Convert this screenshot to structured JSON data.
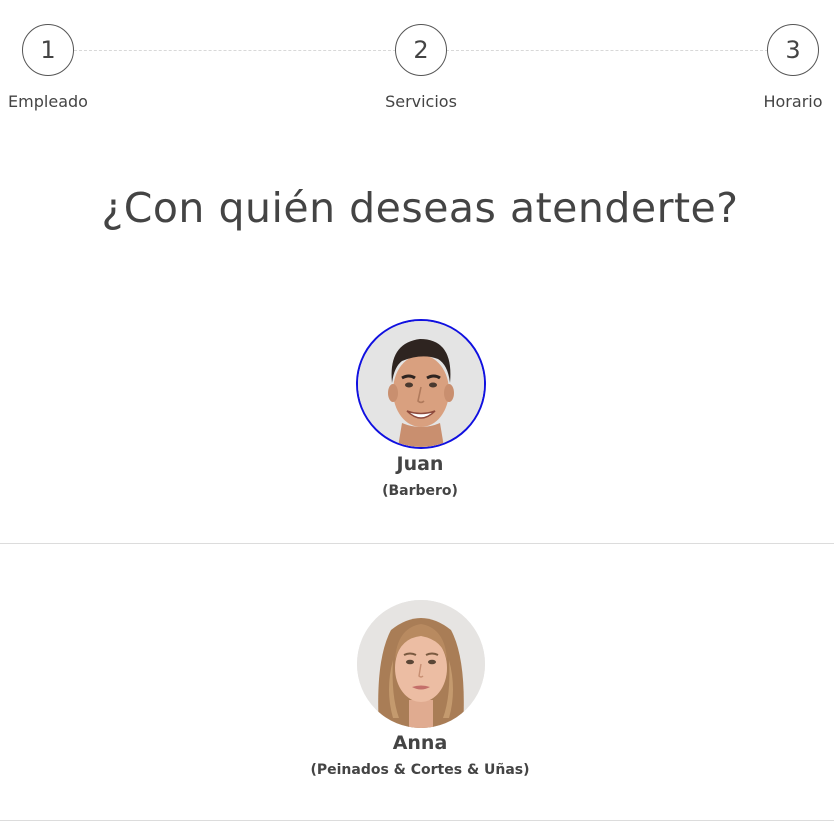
{
  "steps": [
    {
      "number": "1",
      "label": "Empleado"
    },
    {
      "number": "2",
      "label": "Servicios"
    },
    {
      "number": "3",
      "label": "Horario"
    }
  ],
  "heading": "¿Con quién deseas atenderte?",
  "employees": [
    {
      "name": "Juan",
      "role": "(Barbero)",
      "selected": true
    },
    {
      "name": "Anna",
      "role": "(Peinados & Cortes & Uñas)",
      "selected": false
    }
  ],
  "colors": {
    "text": "#444444",
    "selection_ring": "#1010e0",
    "divider": "#dcdcdc"
  }
}
